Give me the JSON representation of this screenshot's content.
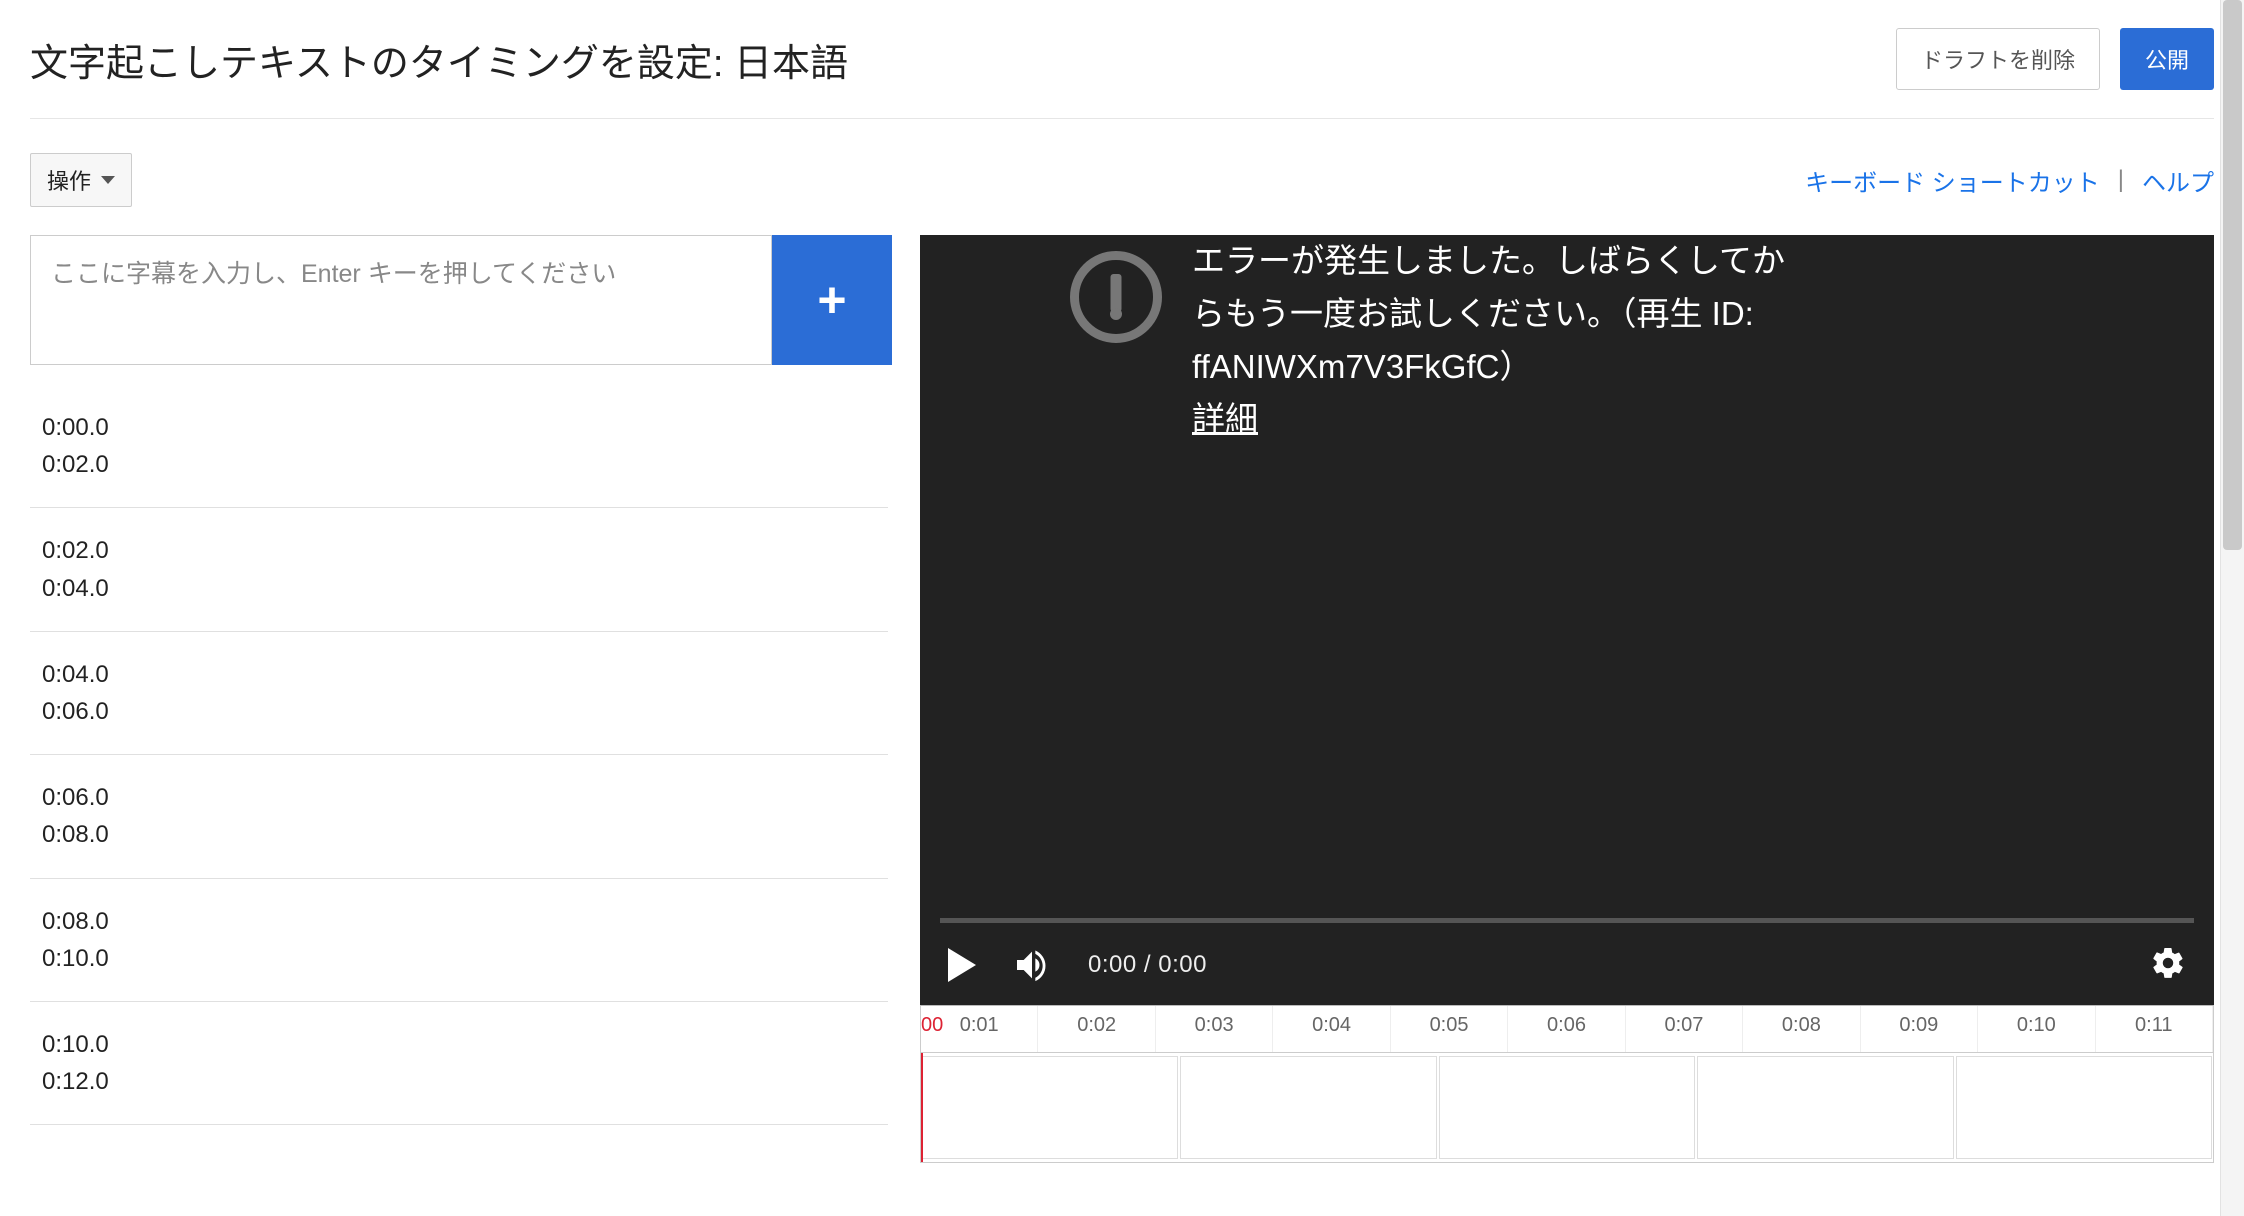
{
  "header": {
    "title": "文字起こしテキストのタイミングを設定: 日本語",
    "delete_draft_label": "ドラフトを削除",
    "publish_label": "公開"
  },
  "toolbar": {
    "actions_label": "操作",
    "keyboard_shortcuts_label": "キーボード ショートカット",
    "help_label": "ヘルプ",
    "separator": "|"
  },
  "input": {
    "placeholder": "ここに字幕を入力し、Enter キーを押してください",
    "add_label": "+"
  },
  "cues": [
    {
      "start": "0:00.0",
      "end": "0:02.0"
    },
    {
      "start": "0:02.0",
      "end": "0:04.0"
    },
    {
      "start": "0:04.0",
      "end": "0:06.0"
    },
    {
      "start": "0:06.0",
      "end": "0:08.0"
    },
    {
      "start": "0:08.0",
      "end": "0:10.0"
    },
    {
      "start": "0:10.0",
      "end": "0:12.0"
    }
  ],
  "player": {
    "error_line1": "エラーが発生しました。しばらくしてか",
    "error_line2": "らもう一度お試しください。（再生 ID:",
    "error_line3": "ffANIWXm7V3FkGfC）",
    "error_more_label": "詳細",
    "time_display": "0:00 / 0:00"
  },
  "timeline": {
    "start_marker": "00",
    "ticks": [
      "0:01",
      "0:02",
      "0:03",
      "0:04",
      "0:05",
      "0:06",
      "0:07",
      "0:08",
      "0:09",
      "0:10",
      "0:11"
    ]
  }
}
